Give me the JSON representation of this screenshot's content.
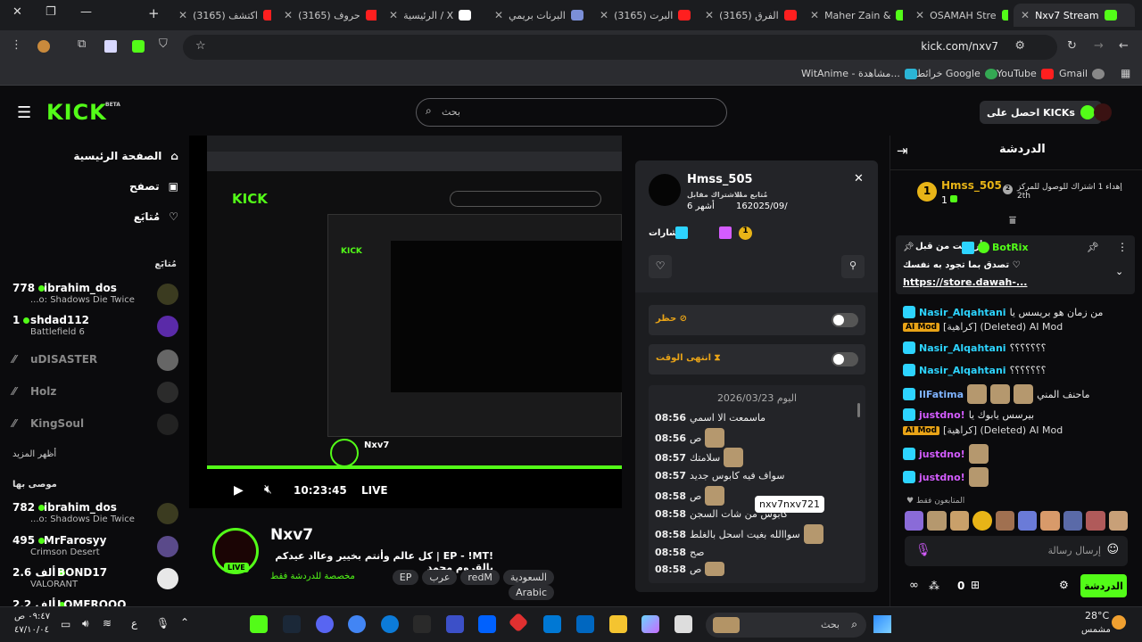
{
  "browser": {
    "tabs": [
      {
        "label": "Nxv7 Stream",
        "fav": "kick",
        "active": true
      },
      {
        "label": "OSAMAH Stre",
        "fav": "kick"
      },
      {
        "label": "Maher Zain &",
        "fav": "kick"
      },
      {
        "label": "(3165) الفرق",
        "fav": "yt"
      },
      {
        "label": "(3165) البرت",
        "fav": "yt"
      },
      {
        "label": "البرنات بريمي",
        "fav": "img"
      },
      {
        "label": "الرئيسية / X",
        "fav": "x"
      },
      {
        "label": "(3165) حروف",
        "fav": "yt"
      },
      {
        "label": "(3165) اكتشف",
        "fav": "yt"
      }
    ],
    "url": "kick.com/nxv7",
    "bookmarks": [
      "Gmail",
      "YouTube",
      "خرائط Google",
      "WitAnime - مشاهدة..."
    ]
  },
  "header": {
    "logo": "KICK",
    "beta": "BETA",
    "search_placeholder": "بحث",
    "get_kicks": "احصل على KICKs"
  },
  "sidebar": {
    "nav": [
      "الصفحة الرئيسية",
      "تصفح",
      "مُتابَع"
    ],
    "following_title": "مُتابَع",
    "following": [
      {
        "count": "778",
        "name": "ibrahim_dos",
        "game": "...o: Shadows Die Twice",
        "live": true
      },
      {
        "count": "1",
        "name": "shdad112",
        "game": "Battlefield 6",
        "live": true
      },
      {
        "name": "uDISASTER",
        "live": false
      },
      {
        "name": "Holz",
        "live": false
      },
      {
        "name": "KingSoul",
        "live": false
      }
    ],
    "show_more": "أظهر المزيد",
    "recommended_title": "موصى بها",
    "recommended": [
      {
        "count": "782",
        "name": "ibrahim_dos",
        "game": "...o: Shadows Die Twice"
      },
      {
        "count": "495",
        "name": "MrFarosyy",
        "game": "Crimson Desert"
      },
      {
        "count": "2.6 ألف",
        "name": "BOND17",
        "game": "VALORANT"
      },
      {
        "count": "2.2 ألف",
        "name": "LOMEROOO",
        "game": ""
      }
    ]
  },
  "video": {
    "time": "10:23:45",
    "live": "LIVE"
  },
  "stream": {
    "name": "Nxv7",
    "title": "!EP - !MT | كل عالم وأنتم بخيير وعااد عيدكم يالقروم محمد",
    "subscribers_only": "مخصصة للدردشة فقط",
    "tags": [
      "السعودية",
      "redM",
      "عرب",
      "EP",
      "Arabic"
    ],
    "live_badge": "LIVE"
  },
  "usercard": {
    "username": "Hmss_505",
    "follow_since_label": "مُتابع منذ",
    "follow_since": "162025/09/",
    "sub_label": "الاشتراك مقابل",
    "sub_value": "6 أشهر",
    "badges_label": "شارات",
    "ban_label": "حظر",
    "timeout_label": "انتهى الوقت",
    "date_header": "اليوم 2026/03/23",
    "messages": [
      {
        "time": "08:56",
        "text": "ماسمعت الا اسمي"
      },
      {
        "time": "08:56",
        "text": "ص"
      },
      {
        "time": "08:57",
        "text": "سلامتك"
      },
      {
        "time": "08:57",
        "text": "سواف فيه كابوس جديد"
      },
      {
        "time": "08:58",
        "text": "ص"
      },
      {
        "time": "08:58",
        "text": "كابوس من شات السجن"
      },
      {
        "time": "08:58",
        "text": "سواالله بغيت اسحل بالغلط"
      },
      {
        "time": "08:58",
        "text": "صح"
      },
      {
        "time": "08:58",
        "text": "ص"
      }
    ],
    "tooltip": "nxv7nxv721"
  },
  "chat": {
    "title": "الدردشة",
    "leader_name": "Hmss_505",
    "leader_count": "1",
    "leader_rank": "2th",
    "leader_hint": "إهداء 1 اشتراك للوصول للمركز",
    "pinned_user": "BotRix",
    "pinned_label": "أرسلت من قبل",
    "pinned_text": "تصدق بما تجود به نفسك",
    "pinned_link": "https://store.dawah-...",
    "messages": [
      {
        "user": "Nasir_Alqahtani",
        "text": "من زمان هو بريسس يا",
        "cls": "nm-b"
      },
      {
        "user": "Nasir_Alqahtani",
        "text": "[كراهية] (Deleted) AI Mod",
        "cls": "nm-b",
        "deleted": true
      },
      {
        "user": "Nasir_Alqahtani",
        "text": "؟؟؟؟؟؟؟",
        "cls": "nm-b"
      },
      {
        "user": "Nasir_Alqahtani",
        "text": "؟؟؟؟؟؟؟",
        "cls": "nm-b"
      },
      {
        "user": "IlFatima",
        "text": "ماحنف المني",
        "cls": "nm-g"
      },
      {
        "user": "justdno!",
        "text": "بيرسس يابوك يا",
        "cls": "nm-p"
      },
      {
        "user": "justdno!",
        "text": "[كراهية] (Deleted) AI Mod",
        "cls": "nm-p",
        "deleted": true
      },
      {
        "user": "justdno!",
        "text": "",
        "cls": "nm-p"
      },
      {
        "user": "justdno!",
        "text": "",
        "cls": "nm-p"
      }
    ],
    "viewers_label": "المتابعون فقط",
    "input_placeholder": "إرسال رسالة",
    "send": "الدردشة",
    "points": "0"
  },
  "taskbar": {
    "weather": "28°C",
    "weather_desc": "مشمس",
    "search": "بحث",
    "time": "٠٩:٤٧ ص",
    "date": "٤٧/١٠/٠٤",
    "lang": "ع"
  }
}
